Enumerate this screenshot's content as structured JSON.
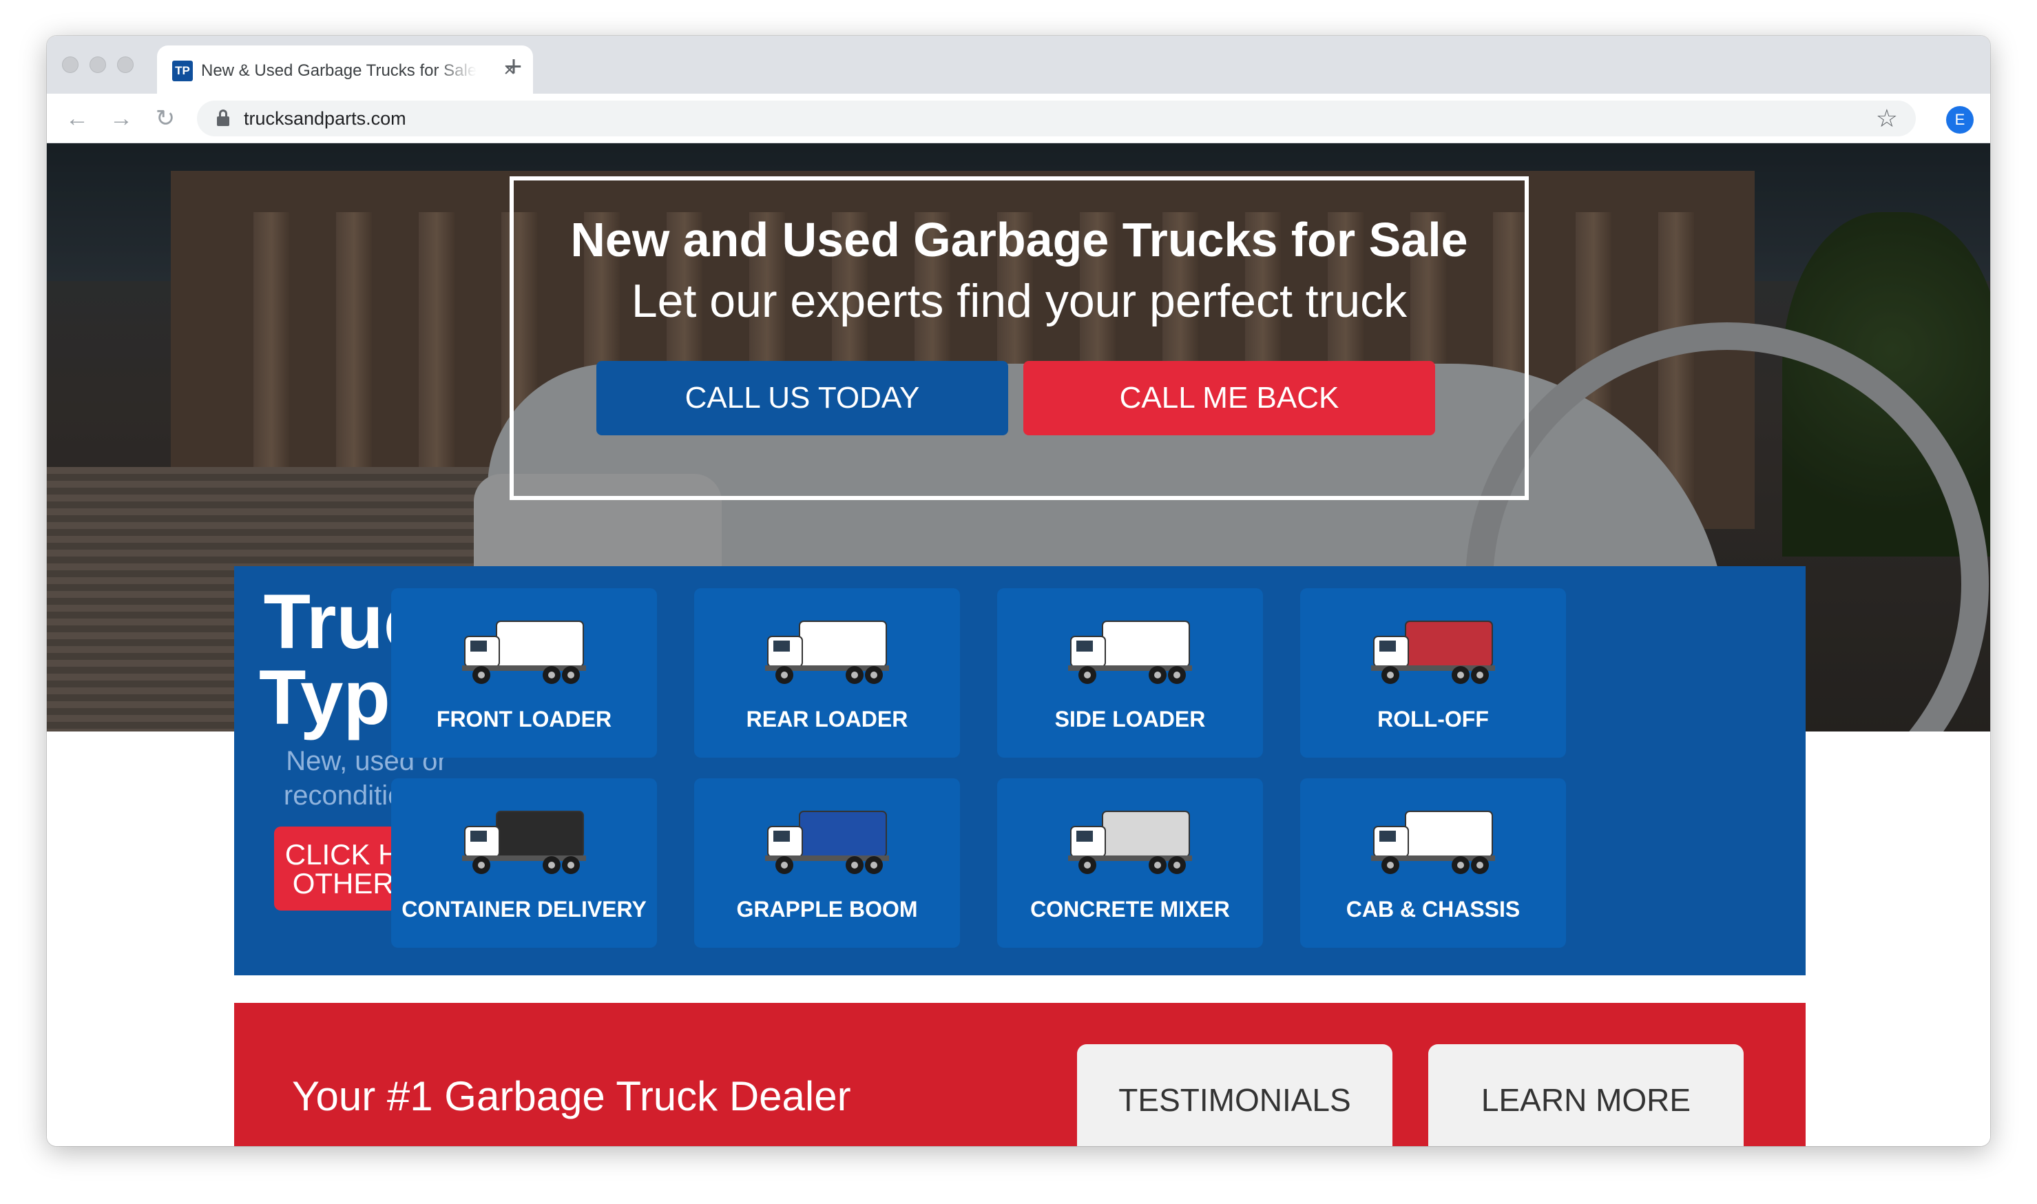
{
  "browser": {
    "tab_title": "New & Used Garbage Trucks for Sale",
    "favicon_text": "TP",
    "url": "trucksandparts.com",
    "profile_initial": "E"
  },
  "hero": {
    "title": "New and Used Garbage Trucks for Sale",
    "subtitle": "Let our experts find your perfect truck",
    "call_button": "CALL US TODAY",
    "callback_button": "CALL ME BACK"
  },
  "truck_types": {
    "heading": "Truck Types",
    "subheading": "New, used or reconditioned",
    "other_button_line1": "CLICK HERE FOR",
    "other_button_line2": "OTHER TRUCKS",
    "items": [
      {
        "label": "FRONT LOADER",
        "icon": "front-loader-truck-icon",
        "body_color": "#ffffff"
      },
      {
        "label": "REAR LOADER",
        "icon": "rear-loader-truck-icon",
        "body_color": "#ffffff"
      },
      {
        "label": "SIDE LOADER",
        "icon": "side-loader-truck-icon",
        "body_color": "#ffffff"
      },
      {
        "label": "ROLL-OFF",
        "icon": "roll-off-truck-icon",
        "body_color": "#c0303a"
      },
      {
        "label": "CONTAINER DELIVERY",
        "icon": "container-delivery-truck-icon",
        "body_color": "#2b2b2b"
      },
      {
        "label": "GRAPPLE BOOM",
        "icon": "grapple-boom-truck-icon",
        "body_color": "#1f4fa8"
      },
      {
        "label": "CONCRETE MIXER",
        "icon": "concrete-mixer-truck-icon",
        "body_color": "#d7d7d7"
      },
      {
        "label": "CAB & CHASSIS",
        "icon": "cab-chassis-truck-icon",
        "body_color": "#ffffff"
      }
    ]
  },
  "dealer": {
    "title": "Your #1 Garbage Truck Dealer",
    "testimonials_button": "TESTIMONIALS",
    "learn_more_button": "LEARN MORE"
  },
  "colors": {
    "brand_blue": "#0d559f",
    "card_blue": "#0b60b3",
    "brand_red": "#e4283a",
    "dealer_red": "#d21f2c"
  }
}
